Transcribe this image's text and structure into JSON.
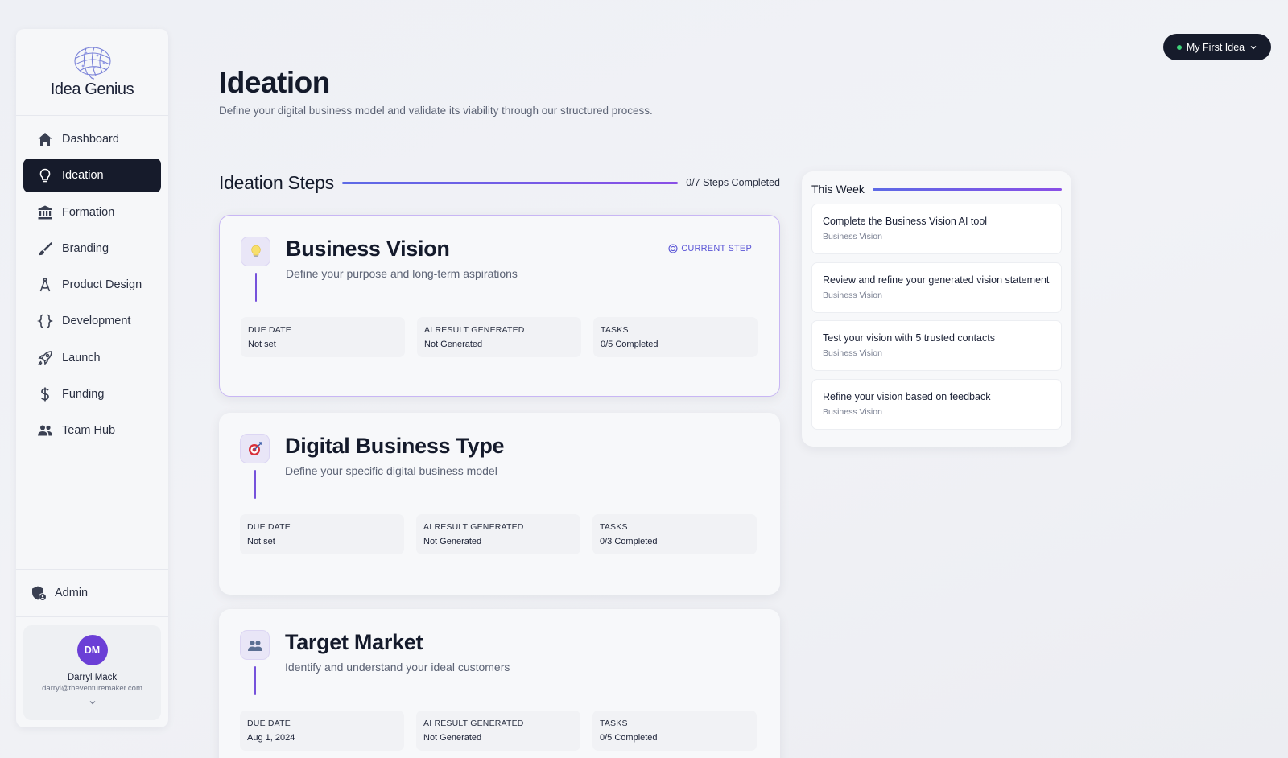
{
  "brand": {
    "name": "Idea Genius"
  },
  "nav": {
    "items": [
      {
        "label": "Dashboard",
        "icon": "home-icon",
        "active": false
      },
      {
        "label": "Ideation",
        "icon": "lightbulb-icon",
        "active": true
      },
      {
        "label": "Formation",
        "icon": "bank-icon",
        "active": false
      },
      {
        "label": "Branding",
        "icon": "brush-icon",
        "active": false
      },
      {
        "label": "Product Design",
        "icon": "compass-icon",
        "active": false
      },
      {
        "label": "Development",
        "icon": "code-braces-icon",
        "active": false
      },
      {
        "label": "Launch",
        "icon": "rocket-icon",
        "active": false
      },
      {
        "label": "Funding",
        "icon": "dollar-icon",
        "active": false
      },
      {
        "label": "Team Hub",
        "icon": "team-icon",
        "active": false
      }
    ],
    "admin_label": "Admin"
  },
  "user": {
    "initials": "DM",
    "name": "Darryl Mack",
    "email": "darryl@theventuremaker.com"
  },
  "idea_selector": {
    "label": "My First Idea",
    "status_color": "#3ed37a"
  },
  "header": {
    "title": "Ideation",
    "subtitle": "Define your digital business model and validate its viability through our structured process."
  },
  "steps_section": {
    "title": "Ideation Steps",
    "progress_text": "0/7 Steps Completed"
  },
  "steps": [
    {
      "title": "Business Vision",
      "description": "Define your purpose and long-term aspirations",
      "icon": "lightbulb-icon",
      "badge": "CURRENT STEP",
      "meta": [
        {
          "label": "DUE DATE",
          "value": "Not set"
        },
        {
          "label": "AI RESULT GENERATED",
          "value": "Not Generated"
        },
        {
          "label": "TASKS",
          "value": "0/5 Completed"
        }
      ]
    },
    {
      "title": "Digital Business Type",
      "description": "Define your specific digital business model",
      "icon": "target-icon",
      "meta": [
        {
          "label": "DUE DATE",
          "value": "Not set"
        },
        {
          "label": "AI RESULT GENERATED",
          "value": "Not Generated"
        },
        {
          "label": "TASKS",
          "value": "0/3 Completed"
        }
      ]
    },
    {
      "title": "Target Market",
      "description": "Identify and understand your ideal customers",
      "icon": "people-icon",
      "meta": [
        {
          "label": "DUE DATE",
          "value": "Aug 1, 2024"
        },
        {
          "label": "AI RESULT GENERATED",
          "value": "Not Generated"
        },
        {
          "label": "TASKS",
          "value": "0/5 Completed"
        }
      ]
    }
  ],
  "this_week": {
    "title": "This Week",
    "items": [
      {
        "title": "Complete the Business Vision AI tool",
        "tag": "Business Vision"
      },
      {
        "title": "Review and refine your generated vision statement",
        "tag": "Business Vision"
      },
      {
        "title": "Test your vision with 5 trusted contacts",
        "tag": "Business Vision"
      },
      {
        "title": "Refine your vision based on feedback",
        "tag": "Business Vision"
      }
    ]
  },
  "colors": {
    "accent": "#7652db",
    "dark": "#161b2b",
    "avatar": "#6b3fd6"
  }
}
